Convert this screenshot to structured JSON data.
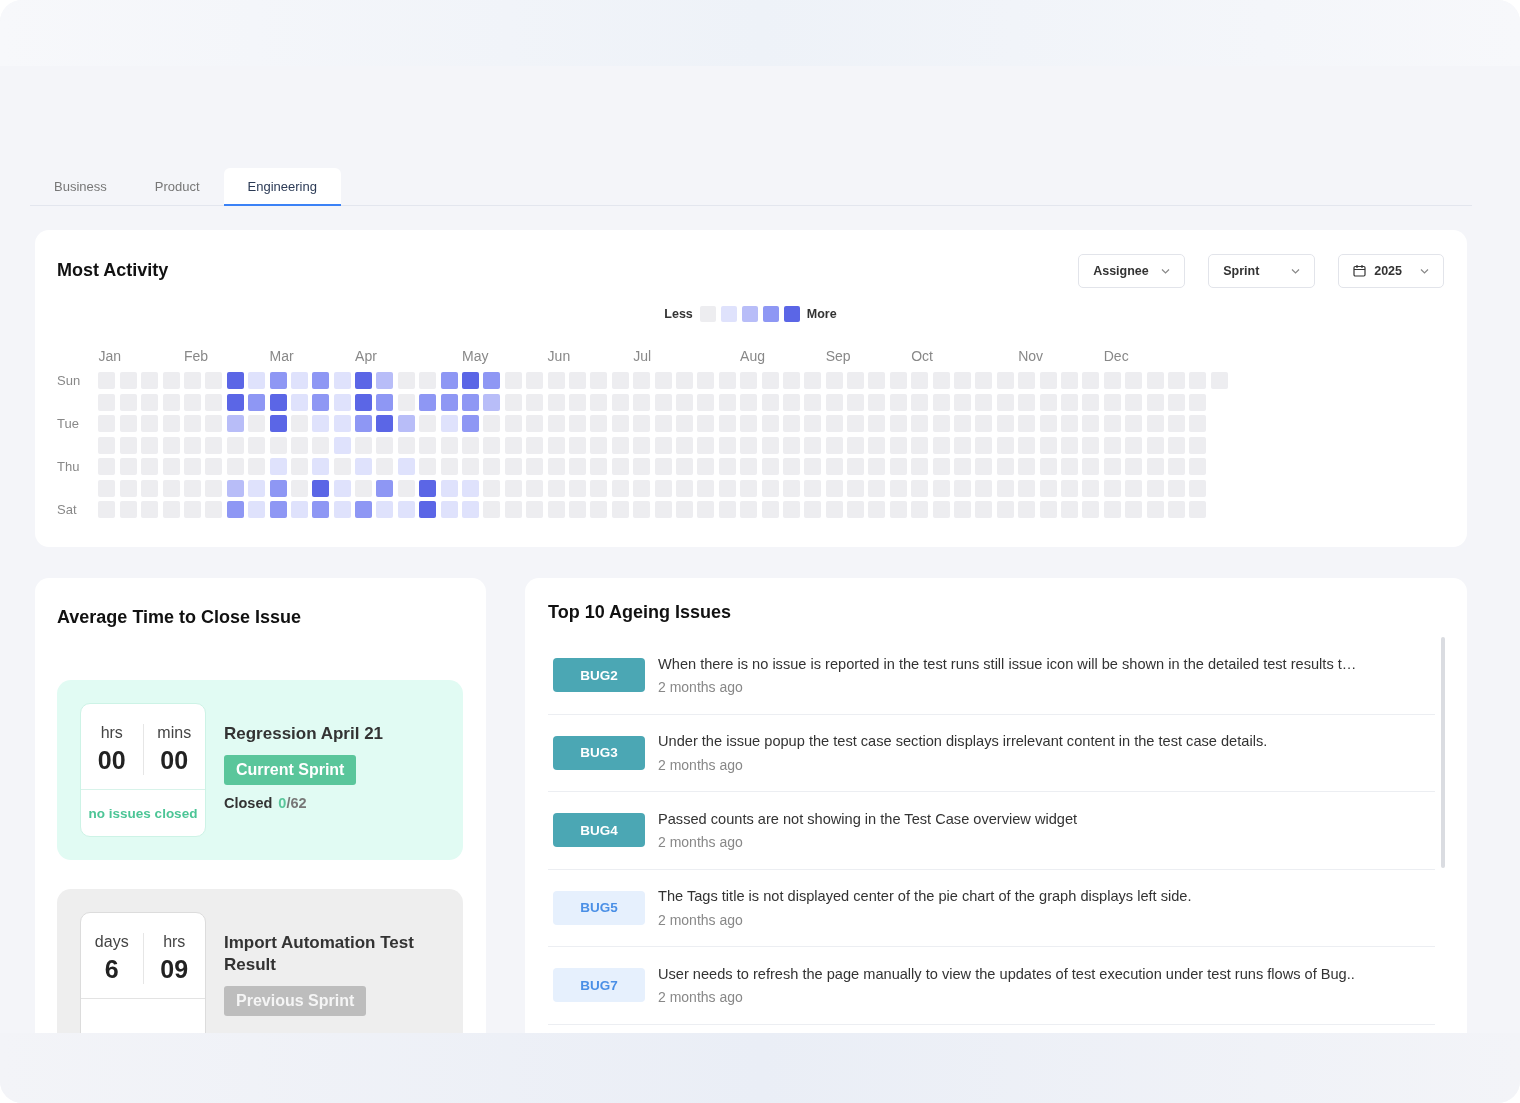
{
  "tabs": [
    {
      "label": "Business",
      "selected": false
    },
    {
      "label": "Product",
      "selected": false
    },
    {
      "label": "Engineering",
      "selected": true
    }
  ],
  "activity": {
    "title": "Most Activity",
    "filters": [
      {
        "kind": "select",
        "label": "Assignee"
      },
      {
        "kind": "select",
        "label": "Sprint"
      },
      {
        "kind": "date",
        "label": "2025"
      }
    ],
    "legend": {
      "low": "Less",
      "high": "More"
    },
    "months": [
      "Jan",
      "Feb",
      "Mar",
      "Apr",
      "May",
      "Jun",
      "Jul",
      "Aug",
      "Sep",
      "Oct",
      "Nov",
      "Dec"
    ],
    "rows": [
      {
        "label": "Sun",
        "cells": [
          {
            "color": "#ededf0"
          },
          {
            "color": "#ededf0"
          },
          {
            "color": "#ededf0"
          },
          {
            "color": "#ededf0"
          },
          {
            "color": "#ededf0"
          },
          {
            "color": "#ededf0"
          },
          {
            "color": "#5b66e6"
          },
          {
            "color": "#dfe2fc"
          },
          {
            "color": "#8e97f4"
          },
          {
            "color": "#dfe2fc"
          },
          {
            "color": "#8e97f4"
          },
          {
            "color": "#dfe2fc"
          },
          {
            "color": "#5b66e6"
          },
          {
            "color": "#b8bdf8"
          },
          {
            "color": "#ededf0"
          },
          {
            "color": "#ededf0"
          },
          {
            "color": "#8e97f4"
          },
          {
            "color": "#5b66e6"
          },
          {
            "color": "#8e97f4"
          },
          {
            "color": "#ededf0"
          },
          {
            "color": "#ededf0"
          },
          {
            "color": "#ededf0"
          },
          {
            "color": "#ededf0"
          },
          {
            "color": "#ededf0"
          },
          {
            "color": "#ededf0"
          },
          {
            "color": "#ededf0"
          },
          {
            "color": "#ededf0"
          },
          {
            "color": "#ededf0"
          },
          {
            "color": "#ededf0"
          },
          {
            "color": "#ededf0"
          },
          {
            "color": "#ededf0"
          },
          {
            "color": "#ededf0"
          },
          {
            "color": "#ededf0"
          },
          {
            "color": "#ededf0"
          },
          {
            "color": "#ededf0"
          },
          {
            "color": "#ededf0"
          },
          {
            "color": "#ededf0"
          },
          {
            "color": "#ededf0"
          },
          {
            "color": "#ededf0"
          },
          {
            "color": "#ededf0"
          },
          {
            "color": "#ededf0"
          },
          {
            "color": "#ededf0"
          },
          {
            "color": "#ededf0"
          },
          {
            "color": "#ededf0"
          },
          {
            "color": "#ededf0"
          },
          {
            "color": "#ededf0"
          },
          {
            "color": "#ededf0"
          },
          {
            "color": "#ededf0"
          },
          {
            "color": "#ededf0"
          },
          {
            "color": "#ededf0"
          },
          {
            "color": "#ededf0"
          },
          {
            "color": "#ededf0"
          },
          {
            "color": "#ededf0"
          }
        ]
      },
      {
        "cells": [
          {
            "color": "#ededf0"
          },
          {
            "color": "#ededf0"
          },
          {
            "color": "#ededf0"
          },
          {
            "color": "#ededf0"
          },
          {
            "color": "#ededf0"
          },
          {
            "color": "#ededf0"
          },
          {
            "color": "#5b66e6"
          },
          {
            "color": "#8e97f4"
          },
          {
            "color": "#5b66e6"
          },
          {
            "color": "#dfe2fc"
          },
          {
            "color": "#8e97f4"
          },
          {
            "color": "#dfe2fc"
          },
          {
            "color": "#5b66e6"
          },
          {
            "color": "#8e97f4"
          },
          {
            "color": "#ededf0"
          },
          {
            "color": "#8e97f4"
          },
          {
            "color": "#8e97f4"
          },
          {
            "color": "#8e97f4"
          },
          {
            "color": "#b8bdf8"
          },
          {
            "color": "#ededf0"
          },
          {
            "color": "#ededf0"
          },
          {
            "color": "#ededf0"
          },
          {
            "color": "#ededf0"
          },
          {
            "color": "#ededf0"
          },
          {
            "color": "#ededf0"
          },
          {
            "color": "#ededf0"
          },
          {
            "color": "#ededf0"
          },
          {
            "color": "#ededf0"
          },
          {
            "color": "#ededf0"
          },
          {
            "color": "#ededf0"
          },
          {
            "color": "#ededf0"
          },
          {
            "color": "#ededf0"
          },
          {
            "color": "#ededf0"
          },
          {
            "color": "#ededf0"
          },
          {
            "color": "#ededf0"
          },
          {
            "color": "#ededf0"
          },
          {
            "color": "#ededf0"
          },
          {
            "color": "#ededf0"
          },
          {
            "color": "#ededf0"
          },
          {
            "color": "#ededf0"
          },
          {
            "color": "#ededf0"
          },
          {
            "color": "#ededf0"
          },
          {
            "color": "#ededf0"
          },
          {
            "color": "#ededf0"
          },
          {
            "color": "#ededf0"
          },
          {
            "color": "#ededf0"
          },
          {
            "color": "#ededf0"
          },
          {
            "color": "#ededf0"
          },
          {
            "color": "#ededf0"
          },
          {
            "color": "#ededf0"
          },
          {
            "color": "#ededf0"
          },
          {
            "color": "#ededf0"
          }
        ]
      },
      {
        "label": "Tue",
        "cells": [
          {
            "color": "#ededf0"
          },
          {
            "color": "#ededf0"
          },
          {
            "color": "#ededf0"
          },
          {
            "color": "#ededf0"
          },
          {
            "color": "#ededf0"
          },
          {
            "color": "#ededf0"
          },
          {
            "color": "#b8bdf8"
          },
          {
            "color": "#ededf0"
          },
          {
            "color": "#5b66e6"
          },
          {
            "color": "#ededf0"
          },
          {
            "color": "#dfe2fc"
          },
          {
            "color": "#dfe2fc"
          },
          {
            "color": "#8e97f4"
          },
          {
            "color": "#5b66e6"
          },
          {
            "color": "#b8bdf8"
          },
          {
            "color": "#ededf0"
          },
          {
            "color": "#dfe2fc"
          },
          {
            "color": "#8e97f4"
          },
          {
            "color": "#ededf0"
          },
          {
            "color": "#ededf0"
          },
          {
            "color": "#ededf0"
          },
          {
            "color": "#ededf0"
          },
          {
            "color": "#ededf0"
          },
          {
            "color": "#ededf0"
          },
          {
            "color": "#ededf0"
          },
          {
            "color": "#ededf0"
          },
          {
            "color": "#ededf0"
          },
          {
            "color": "#ededf0"
          },
          {
            "color": "#ededf0"
          },
          {
            "color": "#ededf0"
          },
          {
            "color": "#ededf0"
          },
          {
            "color": "#ededf0"
          },
          {
            "color": "#ededf0"
          },
          {
            "color": "#ededf0"
          },
          {
            "color": "#ededf0"
          },
          {
            "color": "#ededf0"
          },
          {
            "color": "#ededf0"
          },
          {
            "color": "#ededf0"
          },
          {
            "color": "#ededf0"
          },
          {
            "color": "#ededf0"
          },
          {
            "color": "#ededf0"
          },
          {
            "color": "#ededf0"
          },
          {
            "color": "#ededf0"
          },
          {
            "color": "#ededf0"
          },
          {
            "color": "#ededf0"
          },
          {
            "color": "#ededf0"
          },
          {
            "color": "#ededf0"
          },
          {
            "color": "#ededf0"
          },
          {
            "color": "#ededf0"
          },
          {
            "color": "#ededf0"
          },
          {
            "color": "#ededf0"
          },
          {
            "color": "#ededf0"
          }
        ]
      },
      {
        "cells": [
          {
            "color": "#ededf0"
          },
          {
            "color": "#ededf0"
          },
          {
            "color": "#ededf0"
          },
          {
            "color": "#ededf0"
          },
          {
            "color": "#ededf0"
          },
          {
            "color": "#ededf0"
          },
          {
            "color": "#ededf0"
          },
          {
            "color": "#ededf0"
          },
          {
            "color": "#ededf0"
          },
          {
            "color": "#ededf0"
          },
          {
            "color": "#ededf0"
          },
          {
            "color": "#dfe2fc"
          },
          {
            "color": "#ededf0"
          },
          {
            "color": "#ededf0"
          },
          {
            "color": "#ededf0"
          },
          {
            "color": "#ededf0"
          },
          {
            "color": "#ededf0"
          },
          {
            "color": "#ededf0"
          },
          {
            "color": "#ededf0"
          },
          {
            "color": "#ededf0"
          },
          {
            "color": "#ededf0"
          },
          {
            "color": "#ededf0"
          },
          {
            "color": "#ededf0"
          },
          {
            "color": "#ededf0"
          },
          {
            "color": "#ededf0"
          },
          {
            "color": "#ededf0"
          },
          {
            "color": "#ededf0"
          },
          {
            "color": "#ededf0"
          },
          {
            "color": "#ededf0"
          },
          {
            "color": "#ededf0"
          },
          {
            "color": "#ededf0"
          },
          {
            "color": "#ededf0"
          },
          {
            "color": "#ededf0"
          },
          {
            "color": "#ededf0"
          },
          {
            "color": "#ededf0"
          },
          {
            "color": "#ededf0"
          },
          {
            "color": "#ededf0"
          },
          {
            "color": "#ededf0"
          },
          {
            "color": "#ededf0"
          },
          {
            "color": "#ededf0"
          },
          {
            "color": "#ededf0"
          },
          {
            "color": "#ededf0"
          },
          {
            "color": "#ededf0"
          },
          {
            "color": "#ededf0"
          },
          {
            "color": "#ededf0"
          },
          {
            "color": "#ededf0"
          },
          {
            "color": "#ededf0"
          },
          {
            "color": "#ededf0"
          },
          {
            "color": "#ededf0"
          },
          {
            "color": "#ededf0"
          },
          {
            "color": "#ededf0"
          },
          {
            "color": "#ededf0"
          }
        ]
      },
      {
        "label": "Thu",
        "cells": [
          {
            "color": "#ededf0"
          },
          {
            "color": "#ededf0"
          },
          {
            "color": "#ededf0"
          },
          {
            "color": "#ededf0"
          },
          {
            "color": "#ededf0"
          },
          {
            "color": "#ededf0"
          },
          {
            "color": "#ededf0"
          },
          {
            "color": "#ededf0"
          },
          {
            "color": "#dfe2fc"
          },
          {
            "color": "#ededf0"
          },
          {
            "color": "#dfe2fc"
          },
          {
            "color": "#ededf0"
          },
          {
            "color": "#dfe2fc"
          },
          {
            "color": "#ededf0"
          },
          {
            "color": "#dfe2fc"
          },
          {
            "color": "#ededf0"
          },
          {
            "color": "#ededf0"
          },
          {
            "color": "#ededf0"
          },
          {
            "color": "#ededf0"
          },
          {
            "color": "#ededf0"
          },
          {
            "color": "#ededf0"
          },
          {
            "color": "#ededf0"
          },
          {
            "color": "#ededf0"
          },
          {
            "color": "#ededf0"
          },
          {
            "color": "#ededf0"
          },
          {
            "color": "#ededf0"
          },
          {
            "color": "#ededf0"
          },
          {
            "color": "#ededf0"
          },
          {
            "color": "#ededf0"
          },
          {
            "color": "#ededf0"
          },
          {
            "color": "#ededf0"
          },
          {
            "color": "#ededf0"
          },
          {
            "color": "#ededf0"
          },
          {
            "color": "#ededf0"
          },
          {
            "color": "#ededf0"
          },
          {
            "color": "#ededf0"
          },
          {
            "color": "#ededf0"
          },
          {
            "color": "#ededf0"
          },
          {
            "color": "#ededf0"
          },
          {
            "color": "#ededf0"
          },
          {
            "color": "#ededf0"
          },
          {
            "color": "#ededf0"
          },
          {
            "color": "#ededf0"
          },
          {
            "color": "#ededf0"
          },
          {
            "color": "#ededf0"
          },
          {
            "color": "#ededf0"
          },
          {
            "color": "#ededf0"
          },
          {
            "color": "#ededf0"
          },
          {
            "color": "#ededf0"
          },
          {
            "color": "#ededf0"
          },
          {
            "color": "#ededf0"
          },
          {
            "color": "#ededf0"
          }
        ]
      },
      {
        "cells": [
          {
            "color": "#ededf0"
          },
          {
            "color": "#ededf0"
          },
          {
            "color": "#ededf0"
          },
          {
            "color": "#ededf0"
          },
          {
            "color": "#ededf0"
          },
          {
            "color": "#ededf0"
          },
          {
            "color": "#b8bdf8"
          },
          {
            "color": "#dfe2fc"
          },
          {
            "color": "#8e97f4"
          },
          {
            "color": "#ededf0"
          },
          {
            "color": "#5b66e6"
          },
          {
            "color": "#dfe2fc"
          },
          {
            "color": "#ededf0"
          },
          {
            "color": "#8e97f4"
          },
          {
            "color": "#ededf0"
          },
          {
            "color": "#5b66e6"
          },
          {
            "color": "#dfe2fc"
          },
          {
            "color": "#dfe2fc"
          },
          {
            "color": "#ededf0"
          },
          {
            "color": "#ededf0"
          },
          {
            "color": "#ededf0"
          },
          {
            "color": "#ededf0"
          },
          {
            "color": "#ededf0"
          },
          {
            "color": "#ededf0"
          },
          {
            "color": "#ededf0"
          },
          {
            "color": "#ededf0"
          },
          {
            "color": "#ededf0"
          },
          {
            "color": "#ededf0"
          },
          {
            "color": "#ededf0"
          },
          {
            "color": "#ededf0"
          },
          {
            "color": "#ededf0"
          },
          {
            "color": "#ededf0"
          },
          {
            "color": "#ededf0"
          },
          {
            "color": "#ededf0"
          },
          {
            "color": "#ededf0"
          },
          {
            "color": "#ededf0"
          },
          {
            "color": "#ededf0"
          },
          {
            "color": "#ededf0"
          },
          {
            "color": "#ededf0"
          },
          {
            "color": "#ededf0"
          },
          {
            "color": "#ededf0"
          },
          {
            "color": "#ededf0"
          },
          {
            "color": "#ededf0"
          },
          {
            "color": "#ededf0"
          },
          {
            "color": "#ededf0"
          },
          {
            "color": "#ededf0"
          },
          {
            "color": "#ededf0"
          },
          {
            "color": "#ededf0"
          },
          {
            "color": "#ededf0"
          },
          {
            "color": "#ededf0"
          },
          {
            "color": "#ededf0"
          },
          {
            "color": "#ededf0"
          }
        ]
      },
      {
        "label": "Sat",
        "cells": [
          {
            "color": "#ededf0"
          },
          {
            "color": "#ededf0"
          },
          {
            "color": "#ededf0"
          },
          {
            "color": "#ededf0"
          },
          {
            "color": "#ededf0"
          },
          {
            "color": "#ededf0"
          },
          {
            "color": "#8e97f4"
          },
          {
            "color": "#dfe2fc"
          },
          {
            "color": "#8e97f4"
          },
          {
            "color": "#dfe2fc"
          },
          {
            "color": "#8e97f4"
          },
          {
            "color": "#dfe2fc"
          },
          {
            "color": "#8e97f4"
          },
          {
            "color": "#dfe2fc"
          },
          {
            "color": "#dfe2fc"
          },
          {
            "color": "#5b66e6"
          },
          {
            "color": "#dfe2fc"
          },
          {
            "color": "#dfe2fc"
          },
          {
            "color": "#ededf0"
          },
          {
            "color": "#ededf0"
          },
          {
            "color": "#ededf0"
          },
          {
            "color": "#ededf0"
          },
          {
            "color": "#ededf0"
          },
          {
            "color": "#ededf0"
          },
          {
            "color": "#ededf0"
          },
          {
            "color": "#ededf0"
          },
          {
            "color": "#ededf0"
          },
          {
            "color": "#ededf0"
          },
          {
            "color": "#ededf0"
          },
          {
            "color": "#ededf0"
          },
          {
            "color": "#ededf0"
          },
          {
            "color": "#ededf0"
          },
          {
            "color": "#ededf0"
          },
          {
            "color": "#ededf0"
          },
          {
            "color": "#ededf0"
          },
          {
            "color": "#ededf0"
          },
          {
            "color": "#ededf0"
          },
          {
            "color": "#ededf0"
          },
          {
            "color": "#ededf0"
          },
          {
            "color": "#ededf0"
          },
          {
            "color": "#ededf0"
          },
          {
            "color": "#ededf0"
          },
          {
            "color": "#ededf0"
          },
          {
            "color": "#ededf0"
          },
          {
            "color": "#ededf0"
          },
          {
            "color": "#ededf0"
          },
          {
            "color": "#ededf0"
          },
          {
            "color": "#ededf0"
          },
          {
            "color": "#ededf0"
          },
          {
            "color": "#ededf0"
          },
          {
            "color": "#ededf0"
          },
          {
            "color": "#ededf0"
          }
        ]
      }
    ]
  },
  "close_time": {
    "title": "Average Time to Close Issue",
    "sprints": [
      {
        "kind": "current",
        "units": [
          {
            "label": "hrs",
            "value": "00"
          },
          {
            "label": "mins",
            "value": "00"
          }
        ],
        "status": "no issues closed",
        "name": "Regression April 21",
        "tag": "Current Sprint",
        "closed_label": "Closed",
        "closed_count": "0/62"
      },
      {
        "kind": "previous",
        "units": [
          {
            "label": "days",
            "value": "6"
          },
          {
            "label": "hrs",
            "value": "09"
          }
        ],
        "name": "Import Automation Test Result",
        "tag": "Previous Sprint"
      }
    ]
  },
  "ageing": {
    "title": "Top 10 Ageing Issues",
    "issues": [
      {
        "id": "BUG2",
        "color": "#4ba7b4",
        "title": "When there is no issue is reported in the test runs still issue icon will be shown in the detailed test results t…",
        "age": "2 months ago"
      },
      {
        "id": "BUG3",
        "color": "#4ba7b4",
        "title": "Under the issue popup the test case section displays irrelevant content in the test case details.",
        "age": "2 months ago"
      },
      {
        "id": "BUG4",
        "color": "#4ba7b4",
        "title": "Passed counts are not showing in the Test Case overview widget",
        "age": "2 months ago"
      },
      {
        "id": "BUG5",
        "color": "#e6f0fd",
        "title": "The Tags title is not displayed center of the pie chart of the graph displays left side.",
        "age": "2 months ago"
      },
      {
        "id": "BUG7",
        "color": "#e6f0fd",
        "title": "User needs to refresh the page manually to view the updates of test execution under test runs flows of Bug..",
        "age": "2 months ago"
      }
    ]
  }
}
